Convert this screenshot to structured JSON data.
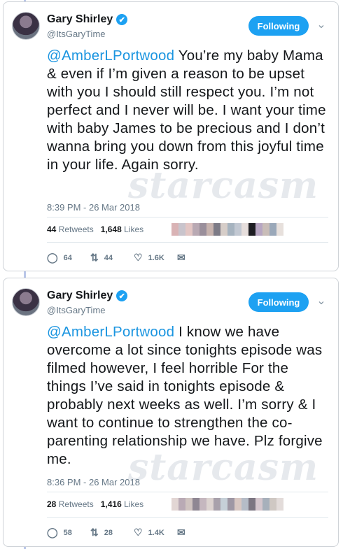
{
  "tweets": [
    {
      "name": "Gary Shirley",
      "handle": "@ItsGaryTime",
      "verified_icon": "✔",
      "follow_label": "Following",
      "mention": "@AmberLPortwood",
      "body": " You’re my baby Mama & even if I’m given a reason to be upset with you I should still respect you. I’m not perfect and I never will be. I want your time with baby James to be precious and I don’t wanna bring you down from this joyful time in your life. Again sorry.",
      "timestamp": "8:39 PM - 26 Mar 2018",
      "retweets_count": "44",
      "retweets_label": "Retweets",
      "likes_count": "1,648",
      "likes_label": "Likes",
      "replies": "64",
      "retweets_action": "44",
      "likes_action": "1.6K",
      "watermark": "starcasm"
    },
    {
      "name": "Gary Shirley",
      "handle": "@ItsGaryTime",
      "verified_icon": "✔",
      "follow_label": "Following",
      "mention": "@AmberLPortwood",
      "body": " I know we have overcome a lot since tonights episode was filmed however, I feel horrible For the things I’ve said in tonights episode & probably next weeks as well. I’m sorry & I want to continue to strengthen the co-parenting relationship we have. Plz forgive me.",
      "timestamp": "8:36 PM - 26 Mar 2018",
      "retweets_count": "28",
      "retweets_label": "Retweets",
      "likes_count": "1,416",
      "likes_label": "Likes",
      "replies": "58",
      "retweets_action": "28",
      "likes_action": "1.4K",
      "watermark": "starcasm"
    }
  ],
  "icons": {
    "reply": "reply-icon",
    "retweet": "retweet-icon",
    "like": "heart-icon",
    "dm": "envelope-icon",
    "more": "chevron-down-icon"
  },
  "colors": {
    "accent": "#1da1f2",
    "mention": "#1b95e0",
    "muted": "#657786"
  }
}
